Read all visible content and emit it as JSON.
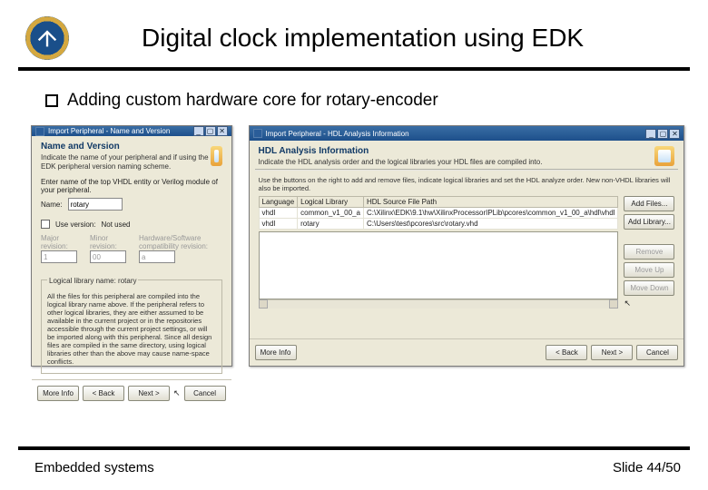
{
  "slide": {
    "title": "Digital clock implementation using EDK",
    "bullet": "Adding custom hardware core for rotary-encoder",
    "footer_left": "Embedded systems",
    "footer_right": "Slide 44/50"
  },
  "dialog_left": {
    "window_title": "Import Peripheral - Name and Version",
    "heading": "Name and Version",
    "description": "Indicate the name of your peripheral and if using the EDK peripheral version naming scheme.",
    "name_prompt": "Enter name of the top VHDL entity or Verilog module of your peripheral.",
    "name_label": "Name:",
    "name_value": "rotary",
    "use_version_label": "Use version:",
    "use_version_value": "Not used",
    "major_label": "Major revision:",
    "minor_label": "Minor revision:",
    "hw_compat_label": "Hardware/Software compatibility revision:",
    "major_value": "1",
    "minor_value": "00",
    "hw_value": "a",
    "group_title": "Logical library name: rotary",
    "group_help": "All the files for this peripheral are compiled into the logical library name above. If the peripheral refers to other logical libraries, they are either assumed to be available in the current project or in the repositories accessible through the current project settings, or will be imported along with this peripheral. Since all design files are compiled in the same directory, using logical libraries other than the above may cause name-space conflicts.",
    "btn_more": "More Info",
    "btn_back": "< Back",
    "btn_next": "Next >",
    "btn_cancel": "Cancel"
  },
  "dialog_right": {
    "window_title": "Import Peripheral - HDL Analysis Information",
    "heading": "HDL Analysis Information",
    "description": "Indicate the HDL analysis order and the logical libraries your HDL files are compiled into.",
    "instr": "Use the buttons on the right to add and remove files, indicate logical libraries and set the HDL analyze order. New non-VHDL libraries will also be imported.",
    "col_lang": "Language",
    "col_lib": "Logical Library",
    "col_path": "HDL Source File Path",
    "rows": [
      {
        "lang": "vhdl",
        "lib": "common_v1_00_a",
        "path": "C:\\Xilinx\\EDK\\9.1\\hw\\XilinxProcessorIPLib\\pcores\\common_v1_00_a\\hdl\\vhdl"
      },
      {
        "lang": "vhdl",
        "lib": "rotary",
        "path": "C:\\Users\\test\\pcores\\src\\rotary.vhd"
      }
    ],
    "btn_add_files": "Add Files...",
    "btn_add_lib": "Add Library...",
    "btn_remove": "Remove",
    "btn_move_up": "Move Up",
    "btn_move_down": "Move Down",
    "btn_more": "More Info",
    "btn_back": "< Back",
    "btn_next": "Next >",
    "btn_cancel": "Cancel"
  }
}
